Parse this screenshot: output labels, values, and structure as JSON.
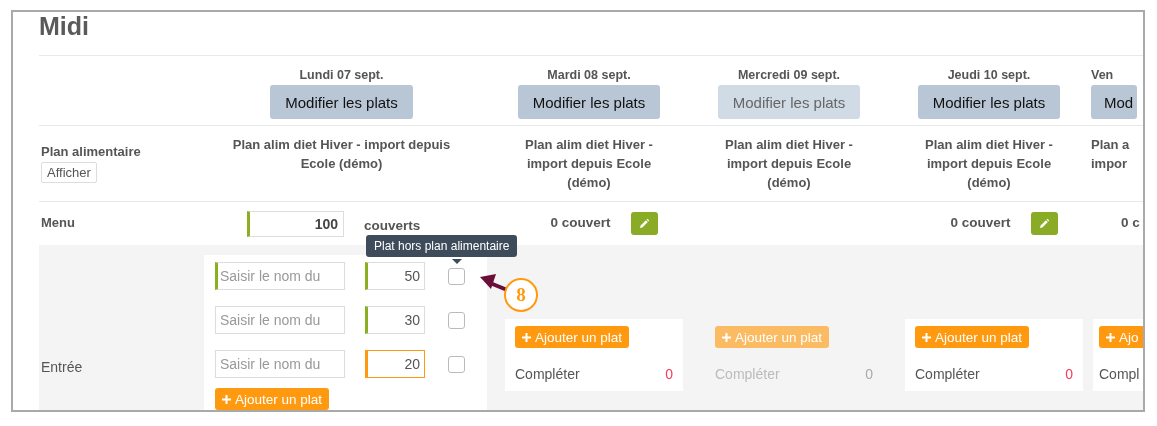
{
  "title": "Midi",
  "row_labels": {
    "plan": "Plan alimentaire",
    "plan_button": "Afficher",
    "menu": "Menu",
    "entree": "Entrée"
  },
  "days": [
    {
      "kind": "editing",
      "date": "Lundi 07 sept.",
      "button": {
        "label": "Modifier les plats"
      },
      "disabled": false,
      "plan_lines": [
        "Plan alim diet Hiver - import depuis",
        "Ecole (démo)"
      ],
      "covers": {
        "value": "100",
        "unit": "couverts"
      },
      "dishes": [
        {
          "placeholder": "Saisir le nom du",
          "named": true,
          "quantity": "50",
          "color": "#8ab022",
          "checked": false,
          "tooltip": "Plat hors plan alimentaire"
        },
        {
          "placeholder": "Saisir le nom du",
          "named": false,
          "quantity": "30",
          "color": "#8ab022",
          "checked": false
        },
        {
          "placeholder": "Saisir le nom du",
          "named": false,
          "quantity": "20",
          "color": "#ff9a10",
          "checked": false
        }
      ],
      "add_button": {
        "label": "Ajouter un plat"
      }
    },
    {
      "kind": "summary",
      "date": "Mardi 08 sept.",
      "button": {
        "label": "Modifier les plats"
      },
      "disabled": false,
      "plan_lines": [
        "Plan alim diet Hiver -",
        "import depuis Ecole",
        "(démo)"
      ],
      "covers": "0 couvert",
      "add_button": {
        "label": "Ajouter un plat"
      },
      "complete": {
        "label": "Compléter",
        "count": "0"
      }
    },
    {
      "kind": "summary",
      "date": "Mercredi 09 sept.",
      "button": {
        "label": "Modifier les plats"
      },
      "disabled": true,
      "plan_lines": [
        "Plan alim diet Hiver -",
        "import depuis Ecole",
        "(démo)"
      ],
      "add_button": {
        "label": "Ajouter un plat"
      },
      "complete": {
        "label": "Compléter",
        "count": "0"
      }
    },
    {
      "kind": "summary",
      "date": "Jeudi 10 sept.",
      "button": {
        "label": "Modifier les plats"
      },
      "disabled": false,
      "plan_lines": [
        "Plan alim diet Hiver -",
        "import depuis Ecole",
        "(démo)"
      ],
      "covers": "0 couvert",
      "add_button": {
        "label": "Ajouter un plat"
      },
      "complete": {
        "label": "Compléter",
        "count": "0"
      }
    },
    {
      "kind": "cut",
      "date": "Ven",
      "button": {
        "label": "Mod"
      },
      "disabled": false,
      "plan_lines": [
        "Plan a",
        "impor"
      ],
      "covers": "0 c",
      "add_button": {
        "label": "Ajo"
      },
      "complete": {
        "label": "Compl"
      }
    }
  ],
  "callout": {
    "label": "8"
  }
}
